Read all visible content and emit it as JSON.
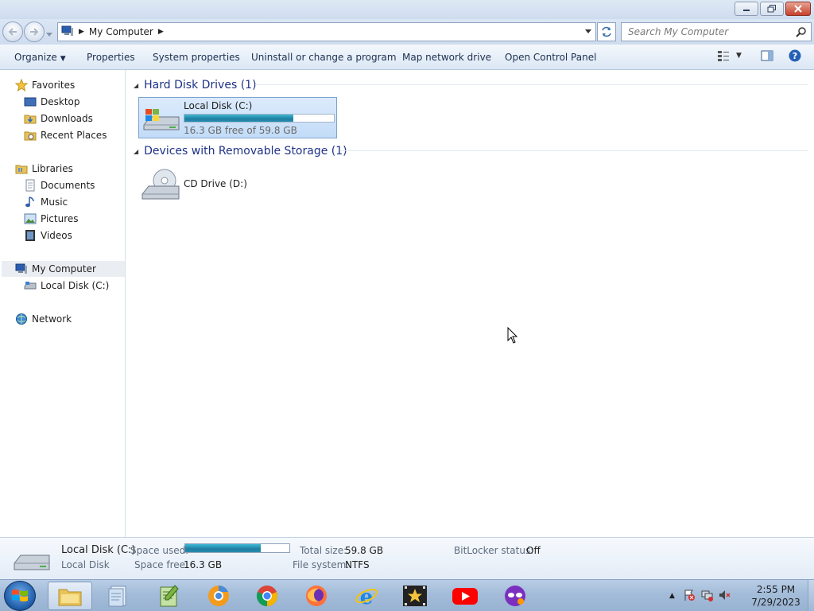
{
  "window": {
    "caption_buttons": [
      "minimize",
      "restore",
      "close"
    ]
  },
  "address": {
    "breadcrumb": "My Computer",
    "search_placeholder": "Search My Computer"
  },
  "toolbar": {
    "organize": "Organize",
    "properties": "Properties",
    "system_properties": "System properties",
    "uninstall": "Uninstall or change a program",
    "map_network": "Map network drive",
    "open_control_panel": "Open Control Panel"
  },
  "sidebar": {
    "favorites": {
      "label": "Favorites",
      "items": [
        "Desktop",
        "Downloads",
        "Recent Places"
      ]
    },
    "libraries": {
      "label": "Libraries",
      "items": [
        "Documents",
        "Music",
        "Pictures",
        "Videos"
      ]
    },
    "computer": {
      "label": "My Computer",
      "items": [
        "Local Disk (C:)"
      ]
    },
    "network": {
      "label": "Network"
    }
  },
  "content": {
    "groups": [
      {
        "title": "Hard Disk Drives (1)",
        "drive": {
          "name": "Local Disk (C:)",
          "free_text": "16.3 GB free of 59.8 GB",
          "used_fraction": 0.727
        }
      },
      {
        "title": "Devices with Removable Storage (1)",
        "drive": {
          "name": "CD Drive (D:)"
        }
      }
    ]
  },
  "details": {
    "name": "Local Disk (C:)",
    "type": "Local Disk",
    "space_used_label": "Space used:",
    "space_free_label": "Space free:",
    "space_free_value": "16.3 GB",
    "total_size_label": "Total size:",
    "total_size_value": "59.8 GB",
    "file_system_label": "File system:",
    "file_system_value": "NTFS",
    "bitlocker_label": "BitLocker status:",
    "bitlocker_value": "Off",
    "used_fraction": 0.727
  },
  "taskbar": {
    "pinned": [
      "windows-explorer-icon",
      "notepad-doc-icon",
      "notepad-plus-icon",
      "chrome-like-orange-icon",
      "chrome-icon",
      "firefox-icon",
      "internet-explorer-icon",
      "video-star-icon",
      "youtube-icon",
      "mask-app-icon"
    ],
    "time": "2:55 PM",
    "date": "7/29/2023"
  }
}
